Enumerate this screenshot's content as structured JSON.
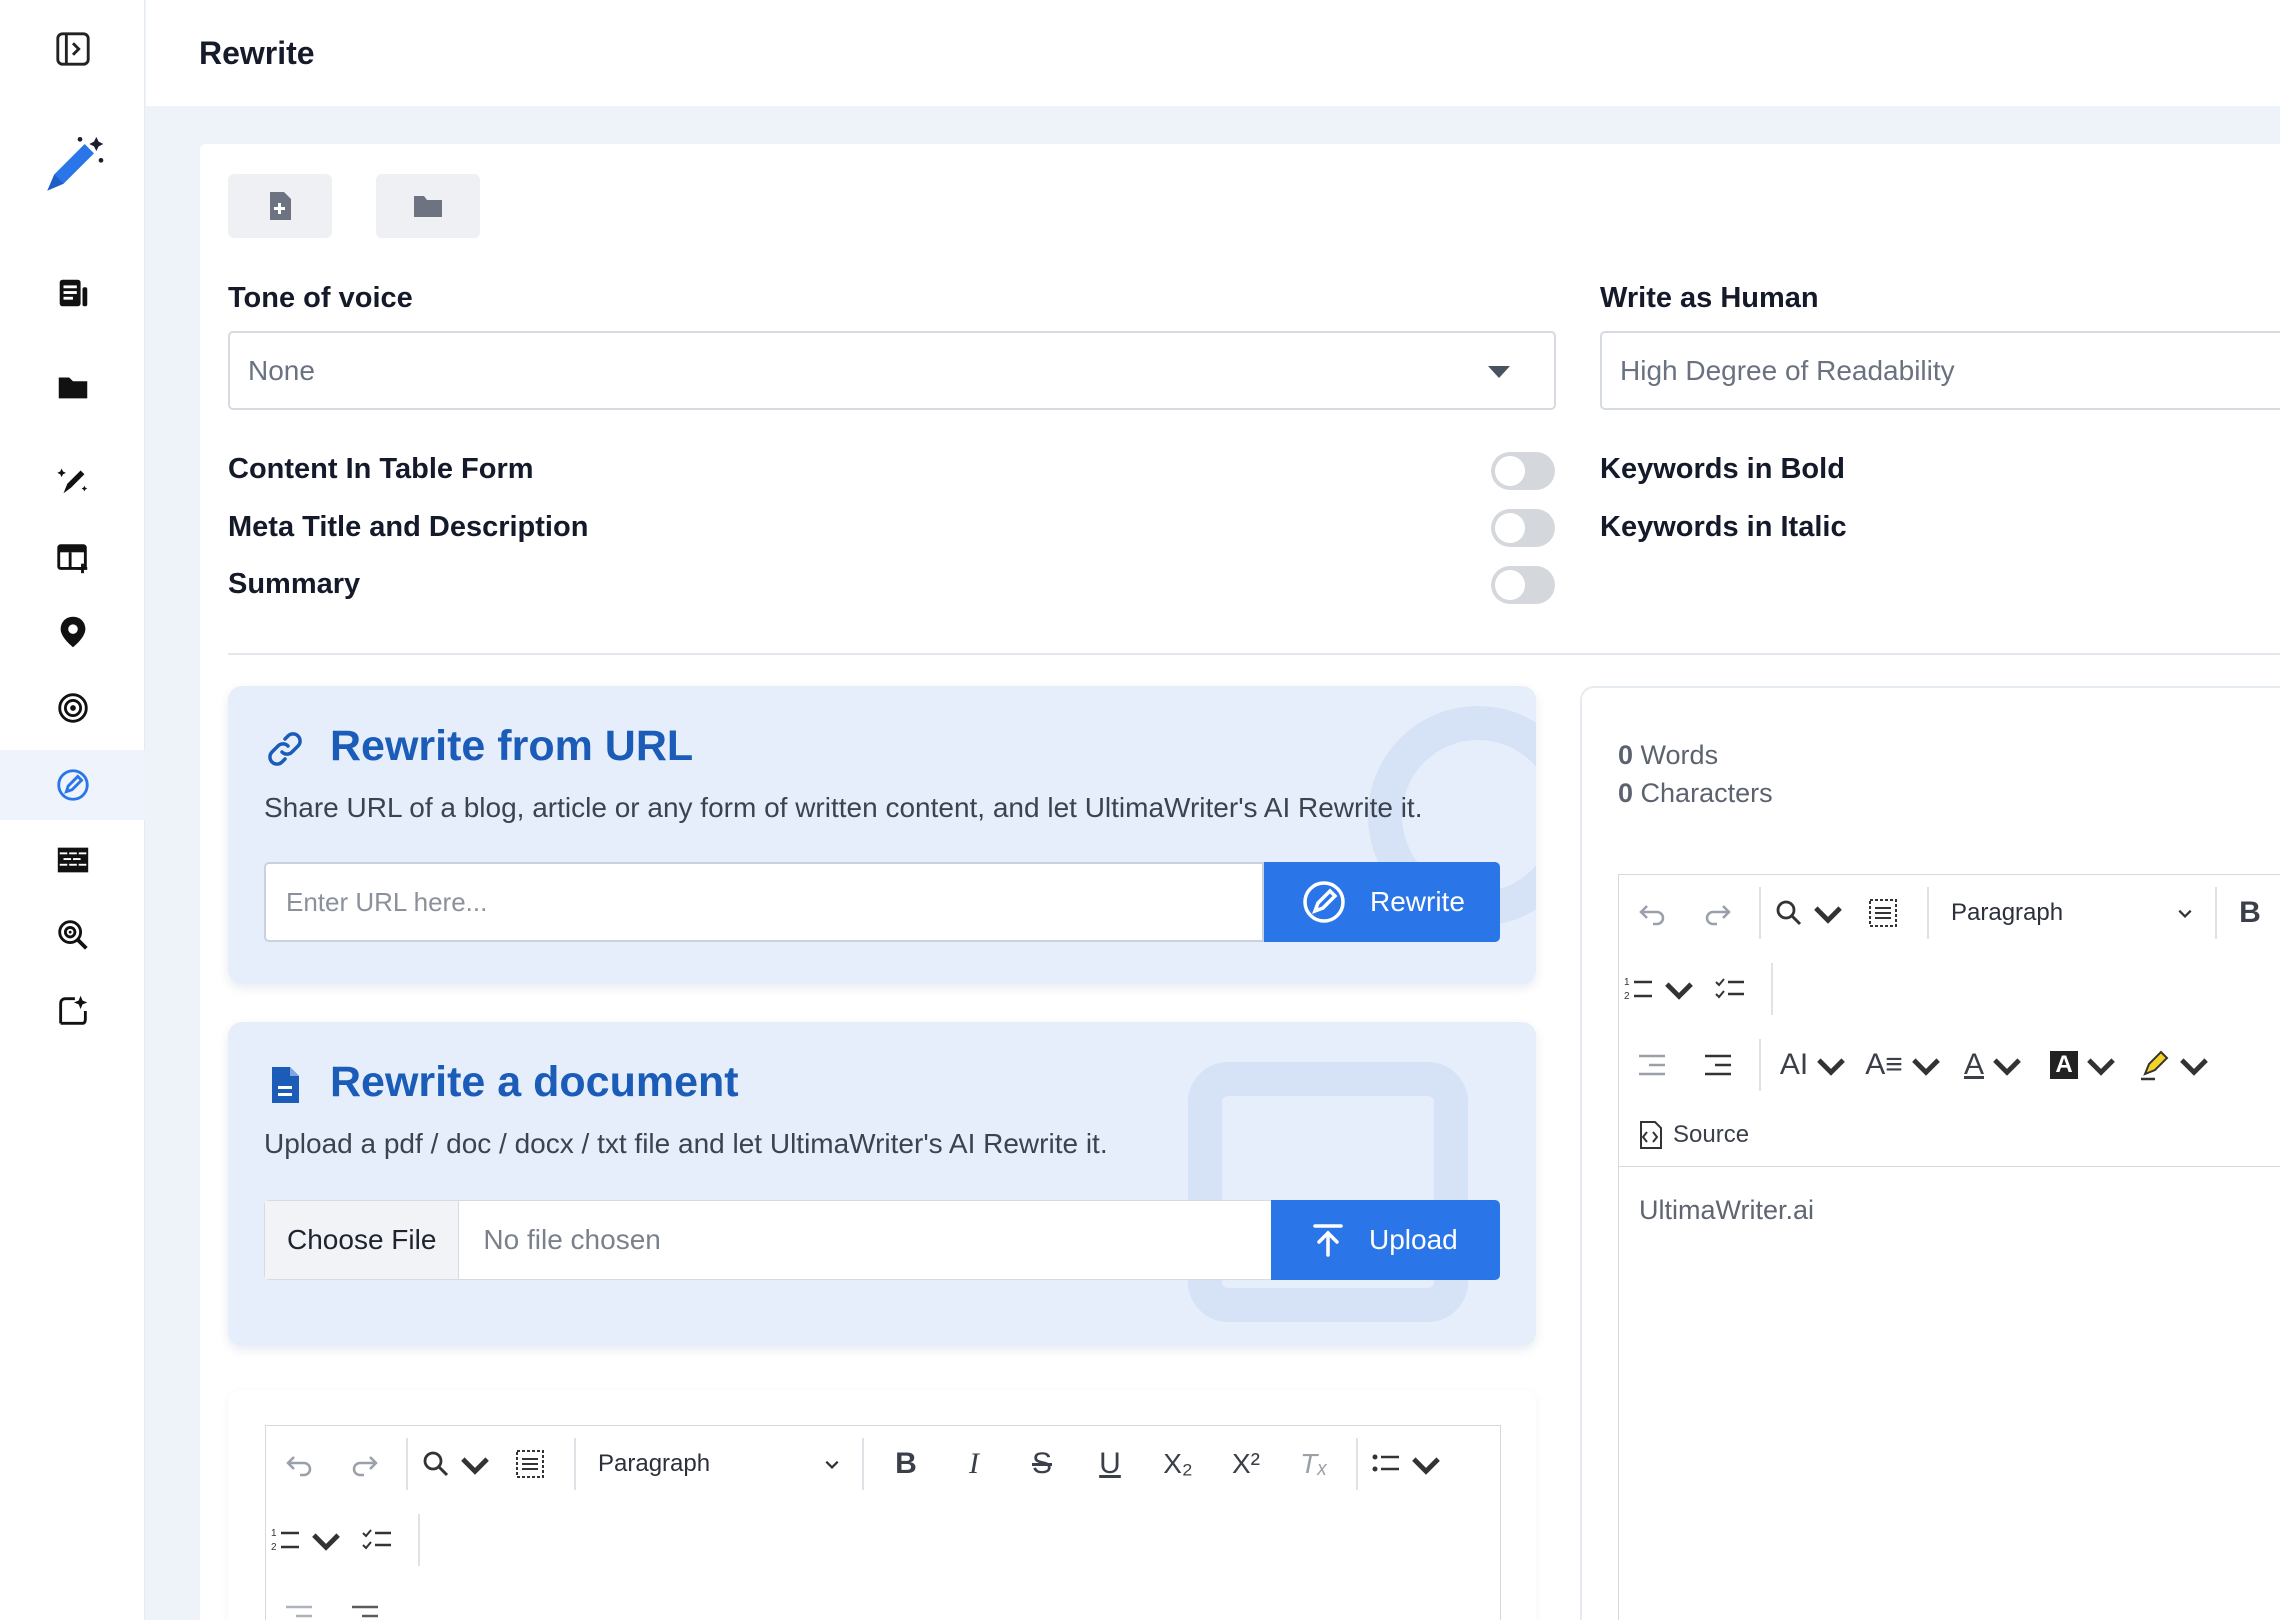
{
  "header": {
    "title": "Rewrite"
  },
  "sidebar": {
    "items": [
      {
        "icon": "sidebar-toggle-icon"
      },
      {
        "icon": "magic-pen-logo-icon"
      },
      {
        "icon": "article-icon"
      },
      {
        "icon": "folder-icon"
      },
      {
        "icon": "ai-pen-icon"
      },
      {
        "icon": "calendar-add-icon"
      },
      {
        "icon": "location-pin-icon"
      },
      {
        "icon": "target-icon"
      },
      {
        "icon": "rewrite-icon",
        "active": true
      },
      {
        "icon": "bricks-icon"
      },
      {
        "icon": "search-target-icon"
      },
      {
        "icon": "sparkle-edit-icon"
      }
    ]
  },
  "toolbar": {
    "new_doc_icon": "new-file-icon",
    "open_folder_icon": "folder-icon"
  },
  "settings": {
    "tone_label": "Tone of voice",
    "tone_value": "None",
    "human_label": "Write as Human",
    "human_placeholder": "High Degree of Readability",
    "options_left": [
      "Content In Table Form",
      "Meta Title and Description",
      "Summary"
    ],
    "options_right": [
      "Keywords in Bold",
      "Keywords in Italic"
    ]
  },
  "url_panel": {
    "title": "Rewrite from URL",
    "subtitle": "Share URL of a blog, article or any form of written content, and let UltimaWriter's AI Rewrite it.",
    "placeholder": "Enter URL here...",
    "button": "Rewrite"
  },
  "doc_panel": {
    "title": "Rewrite a document",
    "subtitle": "Upload a pdf / doc / docx / txt file and let UltimaWriter's AI Rewrite it.",
    "choose_file": "Choose File",
    "no_file": "No file chosen",
    "button": "Upload"
  },
  "editor": {
    "paragraph": "Paragraph",
    "source": "Source",
    "content": "UltimaWriter.ai",
    "words_count": "0",
    "words_label": "Words",
    "chars_count": "0",
    "chars_label": "Characters"
  },
  "colors": {
    "accent": "#2a76e9",
    "panel_bg": "#e6eefb",
    "title_blue": "#1a5cb8"
  }
}
